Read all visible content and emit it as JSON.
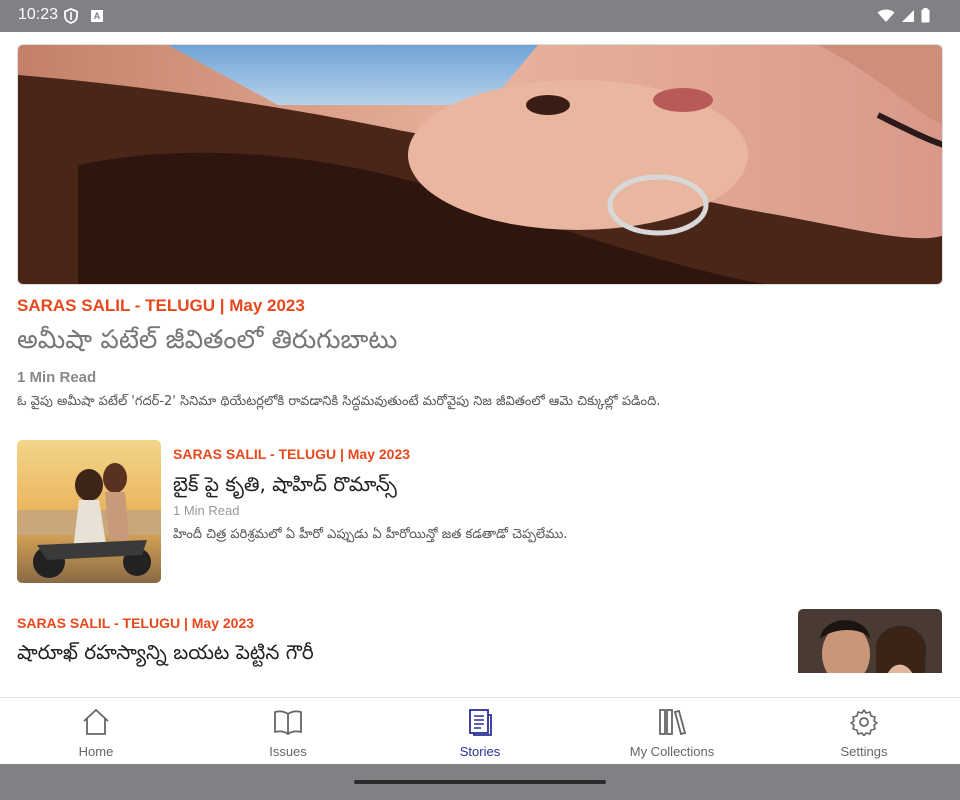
{
  "status_bar": {
    "time": "10:23",
    "icons_left": [
      "shield-icon",
      "a-badge-icon"
    ],
    "icons_right": [
      "wifi-icon",
      "signal-icon",
      "battery-icon"
    ],
    "a_badge": "A"
  },
  "hero": {
    "meta": "SARAS SALIL - TELUGU | May 2023",
    "title": "అమీషా పటేల్ జీవితంలో తిరుగుబాటు",
    "read_time": "1 Min Read",
    "description": "ఓ వైపు అమీషా పటేల్ 'గదర్-2' సినిమా థియేటర్లలోకి రావడానికి సిద్ధమవుతుంటే మరోవైపు నిజ జీవితంలో ఆమె చిక్కుల్లో పడింది."
  },
  "stories": [
    {
      "meta": "SARAS SALIL - TELUGU | May 2023",
      "title": "బైక్ పై కృతి, షాహిద్ రొమాన్స్",
      "read_time": "1 Min Read",
      "description": "హిందీ చిత్ర పరిశ్రమలో ఏ హీరో ఎప్పుడు ఏ హీరోయిన్తో జత కడతాడో చెప్పలేము."
    },
    {
      "meta": "SARAS SALIL - TELUGU | May 2023",
      "title": "షారూఖ్ రహస్యాన్ని బయట పెట్టిన గౌరీ"
    }
  ],
  "nav": {
    "items": [
      {
        "label": "Home",
        "icon": "home-icon"
      },
      {
        "label": "Issues",
        "icon": "book-icon"
      },
      {
        "label": "Stories",
        "icon": "stories-icon",
        "active": true
      },
      {
        "label": "My Collections",
        "icon": "collections-icon"
      },
      {
        "label": "Settings",
        "icon": "gear-icon"
      }
    ]
  },
  "colors": {
    "accent_orange": "#e8481c",
    "nav_active": "#2a2f9a",
    "system_bar": "#808085"
  }
}
